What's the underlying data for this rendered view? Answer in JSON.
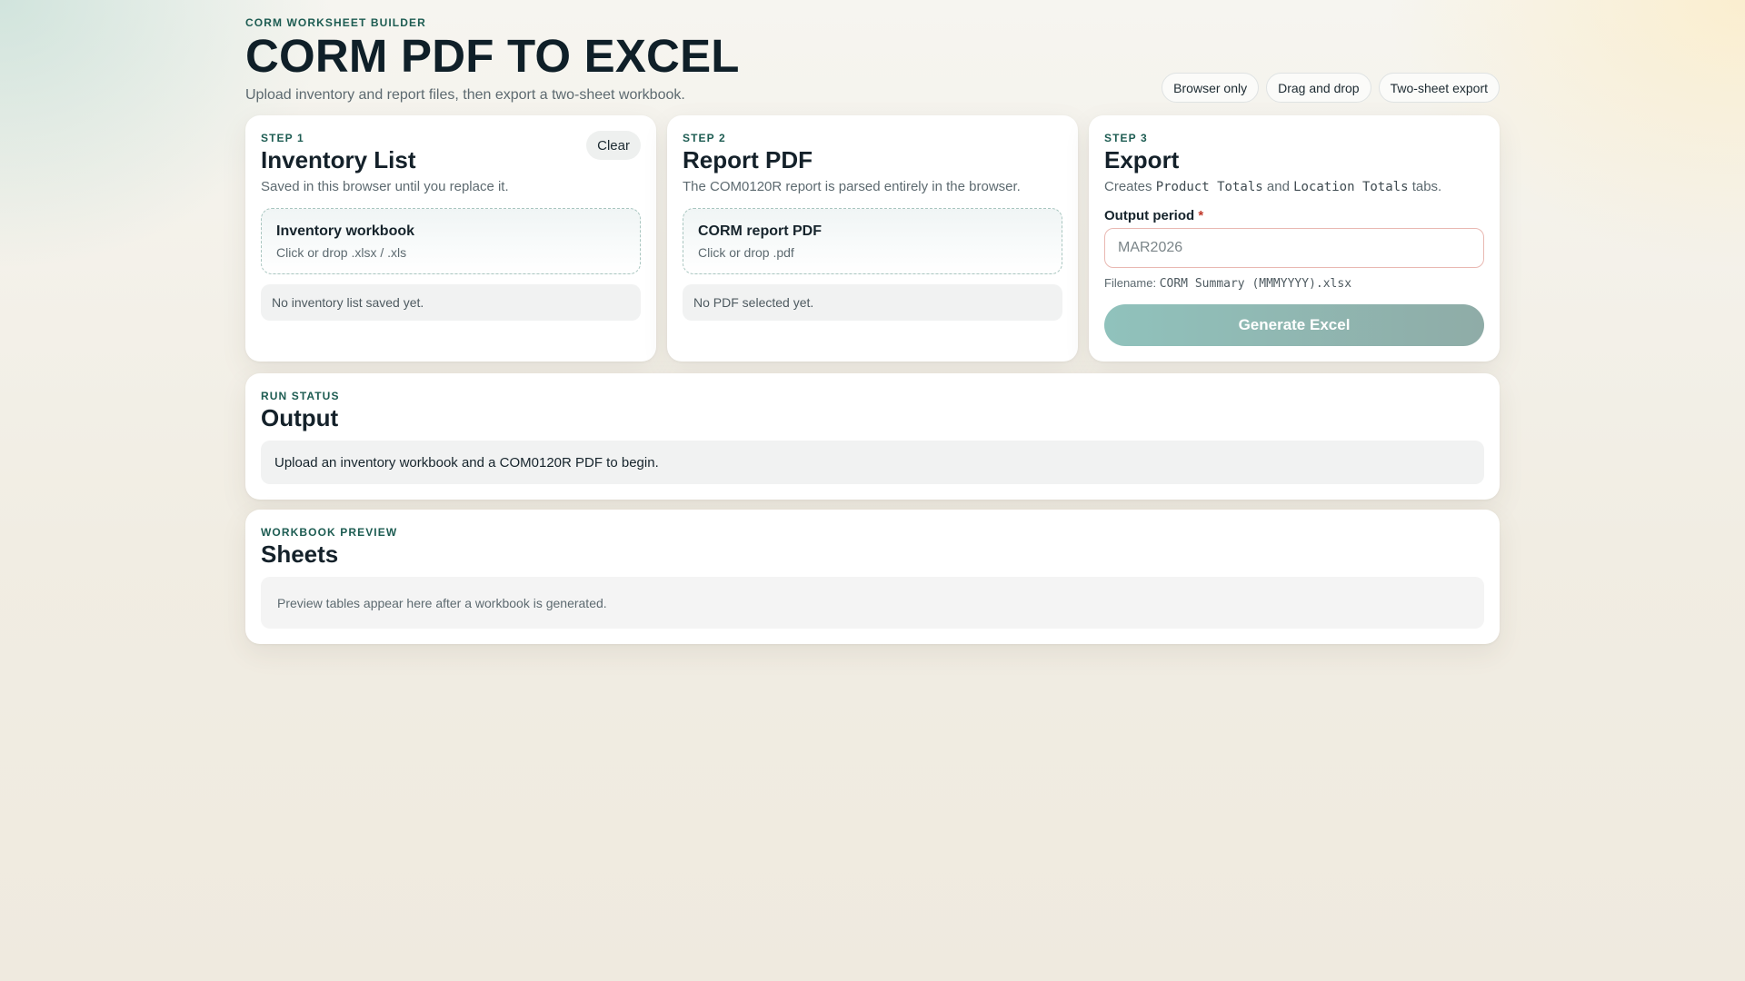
{
  "app": {
    "eyebrow": "CORM WORKSHEET BUILDER",
    "title": "CORM PDF TO EXCEL",
    "subtitle": "Upload inventory and report files, then export a two-sheet workbook.",
    "pills": [
      "Browser only",
      "Drag and drop",
      "Two-sheet export"
    ]
  },
  "step1": {
    "eyebrow": "STEP 1",
    "title": "Inventory List",
    "clear_label": "Clear",
    "description": "Saved in this browser until you replace it.",
    "dropzone_title": "Inventory workbook",
    "dropzone_hint": "Click or drop .xlsx / .xls",
    "status": "No inventory list saved yet."
  },
  "step2": {
    "eyebrow": "STEP 2",
    "title": "Report PDF",
    "description": "The COM0120R report is parsed entirely in the browser.",
    "dropzone_title": "CORM report PDF",
    "dropzone_hint": "Click or drop .pdf",
    "status": "No PDF selected yet."
  },
  "step3": {
    "eyebrow": "STEP 3",
    "title": "Export",
    "desc_prefix": "Creates",
    "desc_tab1": "Product Totals",
    "desc_and": "and",
    "desc_tab2": "Location Totals",
    "desc_suffix": "tabs.",
    "field_label": "Output period",
    "required_mark": "*",
    "period_placeholder": "MAR2026",
    "filename_prefix": "Filename:",
    "filename_value": "CORM Summary (MMMYYYY).xlsx",
    "generate_label": "Generate Excel"
  },
  "run_status": {
    "eyebrow": "RUN STATUS",
    "title": "Output",
    "message": "Upload an inventory workbook and a COM0120R PDF to begin."
  },
  "preview": {
    "eyebrow": "WORKBOOK PREVIEW",
    "title": "Sheets",
    "message": "Preview tables appear here after a workbook is generated."
  },
  "colors": {
    "accent": "#1d5c52",
    "button_start": "#90c2bc",
    "button_end": "#8faca7",
    "required": "#c0392b"
  }
}
